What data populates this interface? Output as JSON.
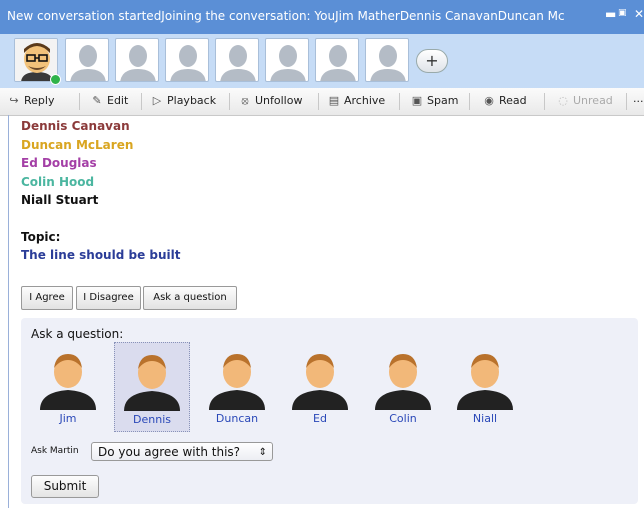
{
  "window": {
    "title": "New conversation startedJoining the conversation: YouJim MatherDennis CanavanDuncan Mc",
    "minimize_icon": "minimize-icon",
    "maximize_icon": "maximize-icon",
    "close_icon": "close-icon"
  },
  "avatars": {
    "participants": [
      "cartoon-avatar",
      "placeholder-avatar",
      "placeholder-avatar",
      "placeholder-avatar",
      "placeholder-avatar",
      "placeholder-avatar",
      "placeholder-avatar",
      "placeholder-avatar"
    ],
    "presence_color": "#2fb34a",
    "add_label": "+"
  },
  "toolbar": {
    "items": [
      {
        "label": "Reply",
        "icon": "reply-icon"
      },
      {
        "label": "Edit",
        "icon": "pencil-icon"
      },
      {
        "label": "Playback",
        "icon": "play-icon"
      },
      {
        "label": "Unfollow",
        "icon": "unfollow-icon"
      },
      {
        "label": "Archive",
        "icon": "archive-icon"
      },
      {
        "label": "Spam",
        "icon": "spam-icon"
      },
      {
        "label": "Read",
        "icon": "eye-icon"
      },
      {
        "label": "Unread",
        "icon": "unread-icon",
        "disabled": true
      }
    ],
    "more_label": "..."
  },
  "participants_list": [
    {
      "name": "Dennis Canavan",
      "color": "#8b3a3a"
    },
    {
      "name": "Duncan McLaren",
      "color": "#d9a520"
    },
    {
      "name": "Ed Douglas",
      "color": "#a43fa6"
    },
    {
      "name": "Colin Hood",
      "color": "#4bb6a0"
    },
    {
      "name": "Niall Stuart",
      "color": "#111111"
    }
  ],
  "topic": {
    "label": "Topic:",
    "value": "The line should be built"
  },
  "vote_buttons": {
    "agree": "I Agree",
    "disagree": "I Disagree",
    "ask": "Ask a question"
  },
  "ask_panel": {
    "title": "Ask a question:",
    "people": [
      "Jim",
      "Dennis",
      "Duncan",
      "Ed",
      "Colin",
      "Niall"
    ],
    "selected": "Dennis",
    "ask_label": "Ask Martin",
    "question_selected": "Do you agree with this?",
    "submit_label": "Submit"
  }
}
